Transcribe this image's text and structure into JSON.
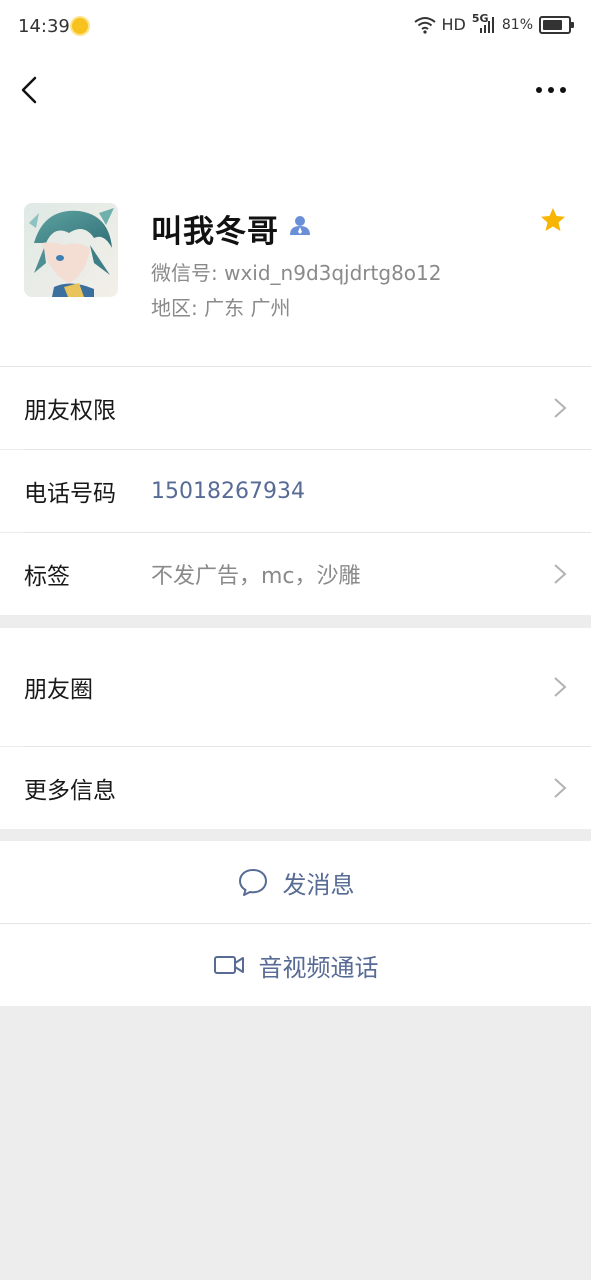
{
  "status_bar": {
    "time": "14:39",
    "network": "HD",
    "cell": "5G",
    "battery_percent": "81%",
    "battery_level": 0.81
  },
  "nav": {
    "back_icon": "chevron-left-icon",
    "more_icon": "more-dots-icon"
  },
  "profile": {
    "name": "叫我冬哥",
    "wechat_id": "微信号: wxid_n9d3qjdrtg8o12",
    "region": "地区: 广东  广州",
    "starred": true,
    "colors": {
      "star": "#f7b500",
      "verified": "#6a8fd9"
    }
  },
  "rows": {
    "permissions": {
      "label": "朋友权限"
    },
    "phone": {
      "label": "电话号码",
      "value": "15018267934"
    },
    "tags": {
      "label": "标签",
      "value": "不发广告，mc，沙雕"
    },
    "moments": {
      "label": "朋友圈"
    },
    "more_info": {
      "label": "更多信息"
    }
  },
  "actions": {
    "message": {
      "label": "发消息",
      "icon": "chat-bubble-icon"
    },
    "call": {
      "label": "音视频通话",
      "icon": "video-camera-icon"
    }
  },
  "colors": {
    "link": "#576b95",
    "secondary_text": "#8a8a8a",
    "background": "#ededed"
  }
}
